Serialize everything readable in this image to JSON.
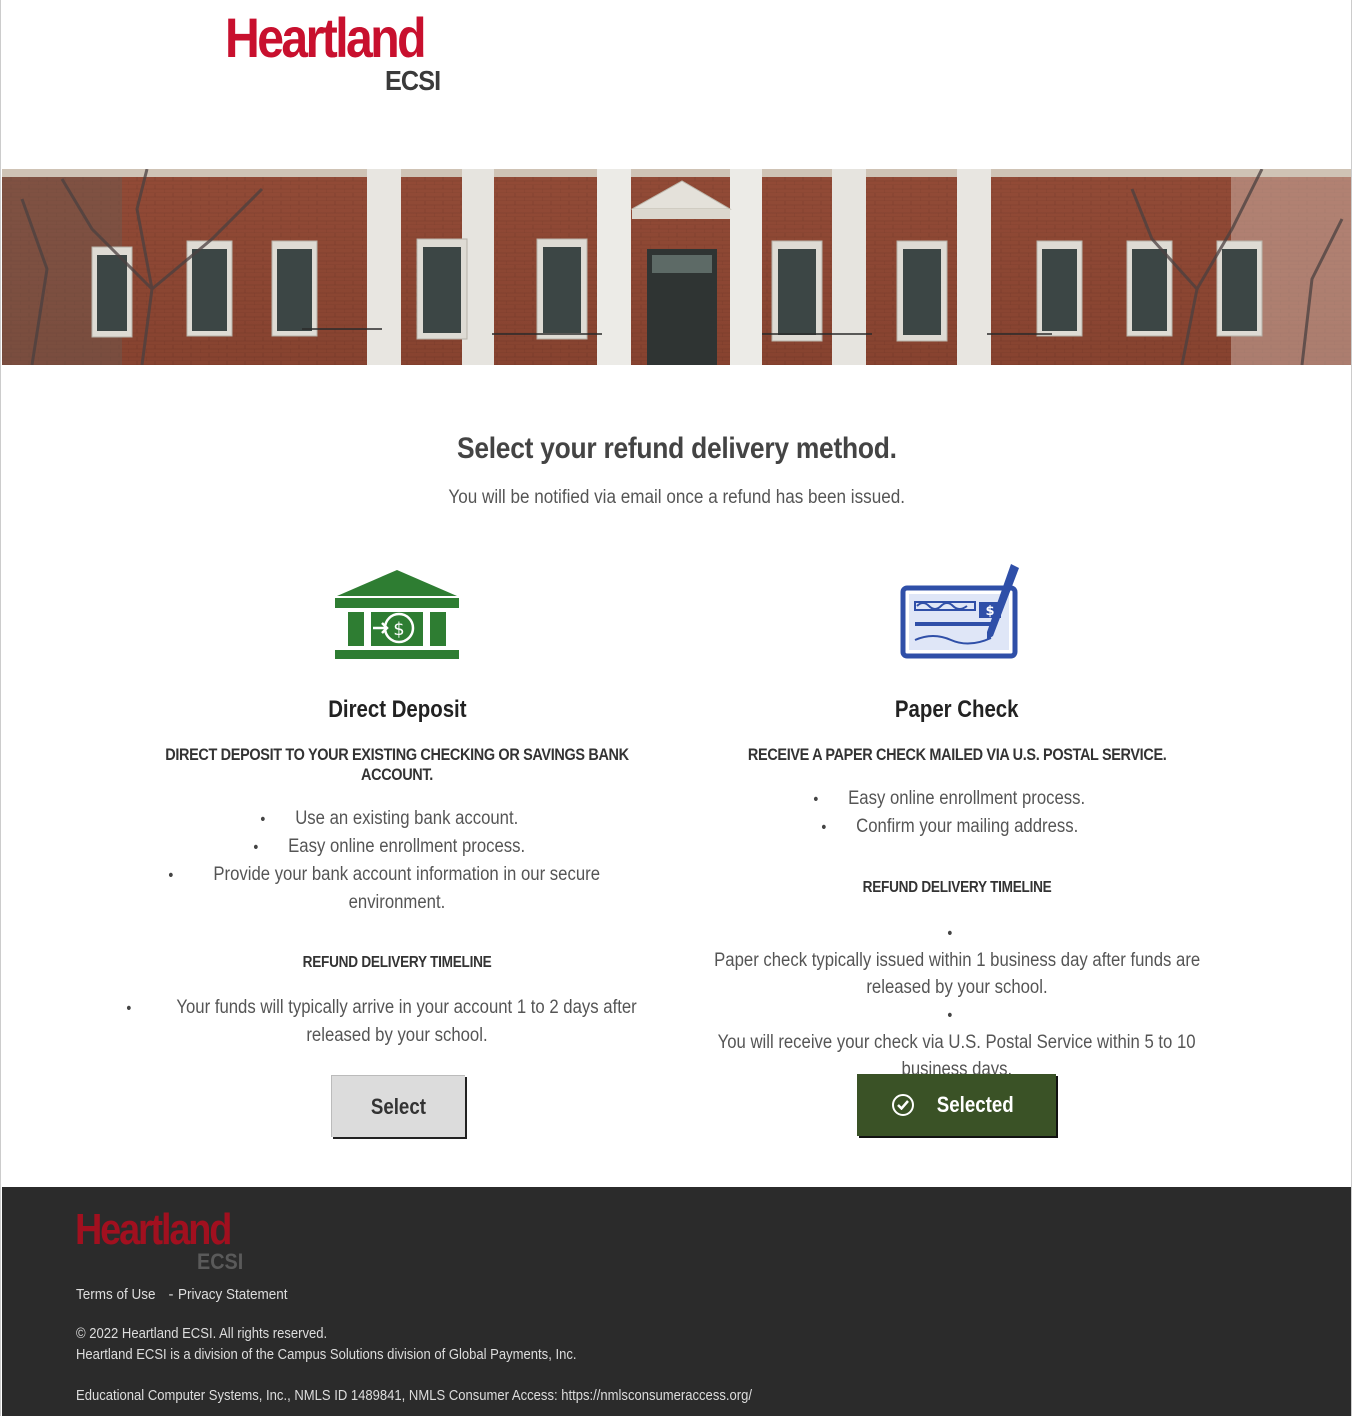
{
  "header": {
    "logo_brand": "Heartland",
    "logo_sub": "ECSI"
  },
  "main": {
    "heading": "Select your refund delivery method.",
    "subheading": "You will be notified via email once a refund has been issued."
  },
  "options": [
    {
      "icon": "bank-icon",
      "title": "Direct Deposit",
      "description": "DIRECT DEPOSIT TO YOUR EXISTING CHECKING OR SAVINGS BANK ACCOUNT.",
      "bullets": [
        "Use an existing bank account.",
        "Easy online enrollment process.",
        "Provide your bank account information in our secure",
        "environment."
      ],
      "timeline_title": "REFUND DELIVERY TIMELINE",
      "timeline": [
        "Your funds will typically arrive in your account 1 to 2 days after",
        "released by your school."
      ],
      "button_label": "Select",
      "selected": false
    },
    {
      "icon": "check-icon",
      "title": "Paper Check",
      "description": "RECEIVE A PAPER CHECK MAILED VIA U.S. POSTAL SERVICE.",
      "bullets": [
        "Easy online enrollment process.",
        "Confirm your mailing address."
      ],
      "timeline_title": "REFUND DELIVERY TIMELINE",
      "timeline": [
        "Paper check typically issued within 1 business day after funds are",
        "released by your school.",
        "You will receive your check via U.S. Postal Service within 5 to 10",
        "business days."
      ],
      "button_label": "Selected",
      "selected": true
    }
  ],
  "footer": {
    "logo_brand": "Heartland",
    "logo_sub": "ECSI",
    "terms_label": "Terms of Use",
    "separator": "-",
    "privacy_label": "Privacy Statement",
    "copyright": "© 2022 Heartland ECSI. All rights reserved.",
    "division": "Heartland ECSI is a division of the Campus Solutions division of Global Payments, Inc.",
    "nmls": "Educational Computer Systems, Inc., NMLS ID 1489841, NMLS Consumer Access:  https://nmlsconsumeraccess.org/"
  },
  "colors": {
    "brand_red": "#c8102e",
    "bank_green": "#2e7d32",
    "check_blue": "#2f4fa8",
    "selected_button": "#3a5226",
    "footer_bg": "#2b2b2b"
  }
}
